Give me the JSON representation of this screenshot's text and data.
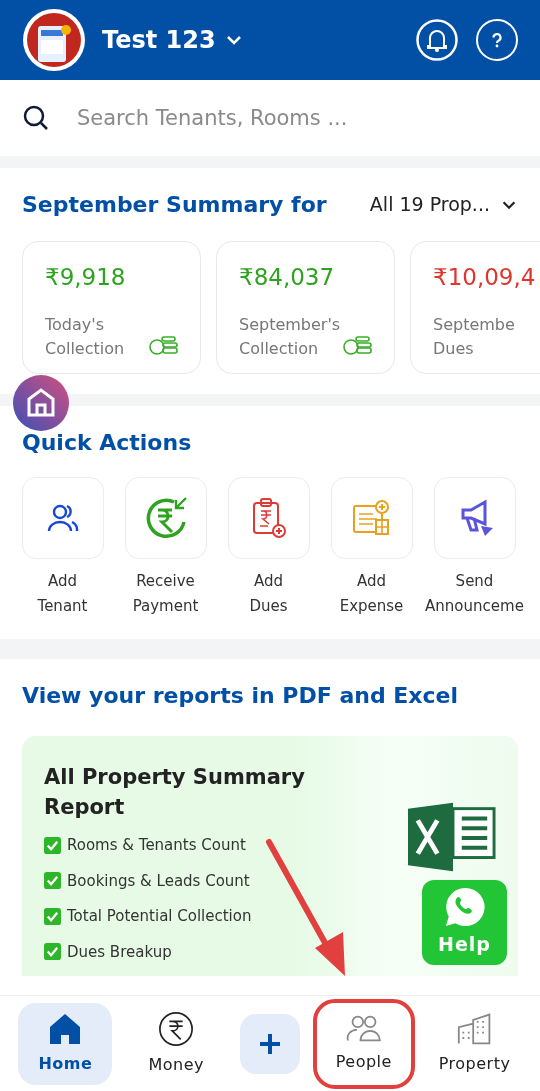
{
  "header": {
    "account_name": "Test 123"
  },
  "search": {
    "placeholder": "Search Tenants, Rooms ..."
  },
  "summary": {
    "title": "September Summary for",
    "filter": "All 19 Prop...",
    "cards": [
      {
        "amount": "₹9,918",
        "label": "Today's Collection",
        "kind": "collection"
      },
      {
        "amount": "₹84,037",
        "label": "September's Collection",
        "kind": "collection"
      },
      {
        "amount": "₹10,09,4",
        "label": "Septembe Dues",
        "kind": "dues"
      }
    ]
  },
  "quick_actions": {
    "title": "Quick Actions",
    "items": [
      {
        "label": "Add Tenant",
        "kind": "tenant"
      },
      {
        "label": "Receive Payment",
        "kind": "payment"
      },
      {
        "label": "Add Dues",
        "kind": "dues"
      },
      {
        "label": "Add Expense",
        "kind": "expense"
      },
      {
        "label": "Send Announceme",
        "kind": "announce"
      }
    ]
  },
  "reports": {
    "title": "View your reports in PDF and Excel",
    "card_title": "All Property Summary Report",
    "items": [
      "Rooms & Tenants Count",
      "Bookings & Leads Count",
      "Total Potential Collection",
      "Dues Breakup"
    ]
  },
  "help_button": {
    "label": "Help"
  },
  "bottom_nav": [
    {
      "label": "Home",
      "kind": "home",
      "selected": true,
      "highlighted": false
    },
    {
      "label": "Money",
      "kind": "money",
      "selected": false,
      "highlighted": false
    },
    {
      "kind": "add",
      "selected": false,
      "highlighted": false
    },
    {
      "label": "People",
      "kind": "people",
      "selected": false,
      "highlighted": true
    },
    {
      "label": "Property",
      "kind": "property",
      "selected": false,
      "highlighted": false
    }
  ]
}
